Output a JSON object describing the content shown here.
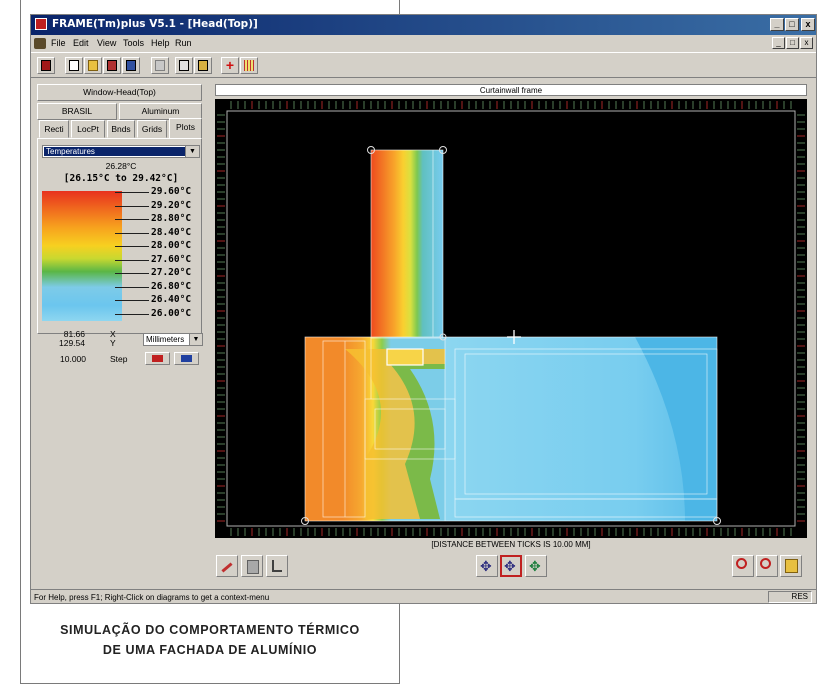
{
  "window": {
    "title": "FRAME(Tm)plus V5.1 - [Head(Top)]",
    "controls": [
      "_",
      "□",
      "x"
    ]
  },
  "menu": [
    "File",
    "Edit",
    "View",
    "Tools",
    "Help",
    "Run"
  ],
  "left_panel": {
    "header": "Window-Head(Top)",
    "country_button": "BRASIL",
    "material_button": "Aluminum",
    "tabs": [
      "Recti",
      "LocPt",
      "Bnds",
      "Grids",
      "Plots"
    ],
    "active_tab": "Plots",
    "plot_type": "Temperatures",
    "current_value": "26.28°C",
    "range": "[26.15°C to 29.42°C]",
    "legend": [
      "29.60°C",
      "29.20°C",
      "28.80°C",
      "28.40°C",
      "28.00°C",
      "27.60°C",
      "27.20°C",
      "26.80°C",
      "26.40°C",
      "26.00°C"
    ],
    "x_value": "81.66",
    "y_value": "129.54",
    "x_label": "X",
    "y_label": "Y",
    "units": "Millimeters",
    "step_value": "10.000",
    "step_label": "Step"
  },
  "canvas": {
    "title": "Curtainwall frame",
    "scale_note": "[DISTANCE BETWEEN TICKS IS 10.00 MM]"
  },
  "status": {
    "help": "For Help, press F1; Right-Click on diagrams to get a context-menu",
    "right": "RES"
  },
  "caption": {
    "line1": "SIMULAÇÃO DO COMPORTAMENTO TÉRMICO",
    "line2": "DE UMA FACHADA DE ALUMÍNIO"
  },
  "colors": {
    "titlebar": "#0a246a",
    "hot": "#e8321e",
    "warm": "#f7d020",
    "mid": "#5ab646",
    "cool": "#6bc6ee",
    "cold": "#8ed6f0"
  },
  "icons": {
    "toolbar": [
      "frame-icon",
      "new-file-icon",
      "open-folder-icon",
      "library-icon",
      "save-icon",
      "print-icon",
      "calc-icon",
      "report-icon",
      "add-icon",
      "grid-icon"
    ],
    "bottom_left": [
      "draw-tool-icon",
      "material-icon",
      "corner-icon"
    ],
    "bottom_center": [
      "pan-icon",
      "pan-selected-icon",
      "zoom-fit-icon"
    ],
    "bottom_right": [
      "zoom-in-icon",
      "zoom-out-icon",
      "info-icon"
    ]
  }
}
